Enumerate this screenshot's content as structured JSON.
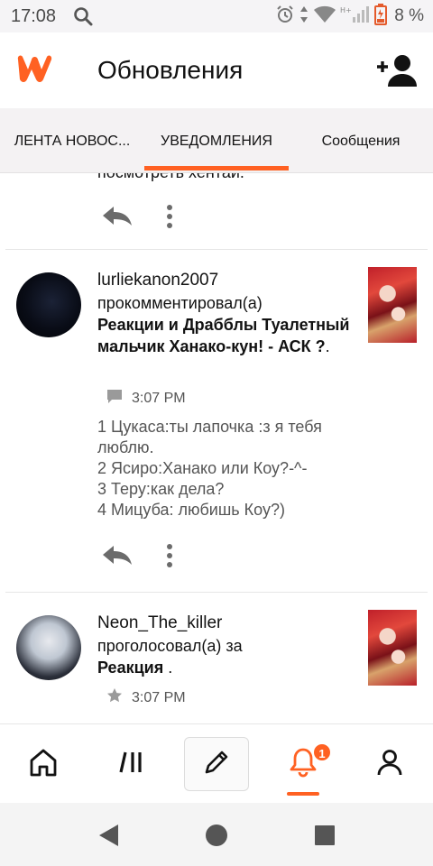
{
  "status_bar": {
    "time": "17:08",
    "battery_percent": "8 %",
    "icons": [
      "search-icon",
      "alarm-icon",
      "data-arrows-icon",
      "wifi-icon",
      "signal-icon",
      "battery-icon"
    ]
  },
  "header": {
    "title": "Обновления",
    "logo": "wattpad-logo",
    "add_user_icon": "add-user-icon"
  },
  "tabs": [
    {
      "label": "ЛЕНТА НОВОС...",
      "active": false
    },
    {
      "label": "УВЕДОМЛЕНИЯ",
      "active": true
    },
    {
      "label": "Сообщения",
      "active": false
    }
  ],
  "feed": {
    "partial_top_text": "посмотреть хентай.",
    "notifications": [
      {
        "username": "lurliekanon2007",
        "action": "прокомментировал(а)",
        "story": "Реакции и Драбблы Туалетный мальчик Ханако-кун! - АСК ?",
        "story_suffix": ".",
        "time": "3:07 PM",
        "meta_icon": "comment-icon",
        "comment": "1 Цукаса:ты лапочка :з я тебя люблю.\n2 Ясиро:Ханако или Коу?-^-\n3 Теру:как дела?\n4 Мицуба: любишь Коу?)"
      },
      {
        "username": "Neon_The_killer",
        "action": "проголосовал(а) за",
        "story": "Реакция",
        "story_suffix": " .",
        "time": "3:07 PM",
        "meta_icon": "star-icon"
      }
    ]
  },
  "bottom_nav": {
    "items": [
      "home-icon",
      "library-icon",
      "write-icon",
      "notifications-icon",
      "profile-icon"
    ],
    "active": "notifications-icon",
    "notification_badge": "1"
  },
  "colors": {
    "accent": "#ff6122",
    "text": "#121212",
    "muted": "#555555",
    "tab_bar_bg": "#f4f2f3"
  }
}
